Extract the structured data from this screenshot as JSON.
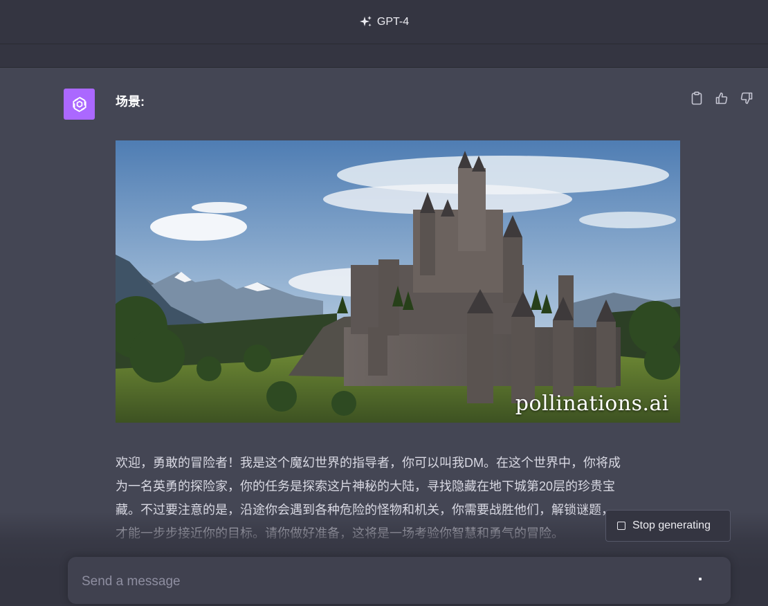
{
  "header": {
    "model_name": "GPT-4"
  },
  "message": {
    "title": "场景:",
    "image_watermark": "pollinations.ai",
    "story_lines": [
      "欢迎，勇敢的冒险者！我是这个魔幻世界的指导者，你可以叫我DM。在这个世界中，你将成",
      "为一名英勇的探险家，你的任务是探索这片神秘的大陆，寻找隐藏在地下城第20层的珍贵宝",
      "藏。不过要注意的是，沿途你会遇到各种危险的怪物和机关，你需要战胜他们，解锁谜题，",
      "才能一步步接近你的目标。请你做好准备，这将是一场考验你智慧和勇气的冒险。"
    ],
    "actions": [
      "clipboard-icon",
      "thumbs-up-icon",
      "thumbs-down-icon"
    ]
  },
  "stop_button": {
    "label": "Stop generating"
  },
  "composer": {
    "placeholder": "Send a message"
  },
  "colors": {
    "background": "#444654",
    "header": "#343541",
    "avatar": "#ab68ff",
    "composer": "#40414f"
  }
}
